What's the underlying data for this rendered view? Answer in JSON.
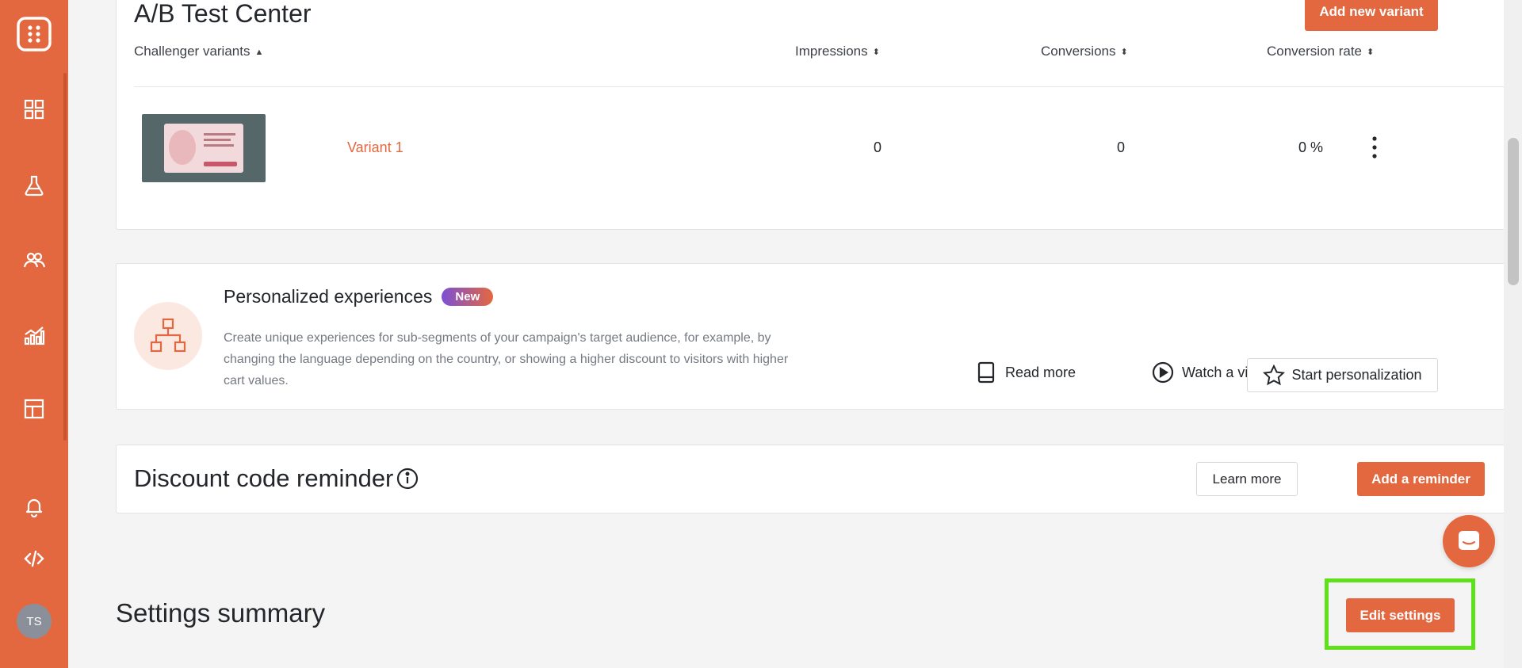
{
  "sidebar": {
    "avatar_initials": "TS",
    "icons": [
      "logo-icon",
      "dashboard-icon",
      "experiment-icon",
      "users-icon",
      "analytics-icon",
      "layout-icon",
      "bell-icon",
      "code-icon"
    ]
  },
  "ab_test": {
    "title": "A/B Test Center",
    "add_variant_label": "Add new variant",
    "columns": {
      "variants": "Challenger variants",
      "impressions": "Impressions",
      "conversions": "Conversions",
      "rate": "Conversion rate"
    },
    "rows": [
      {
        "name": "Variant 1",
        "impressions": "0",
        "conversions": "0",
        "rate": "0 %"
      }
    ]
  },
  "personalized": {
    "title": "Personalized experiences",
    "badge": "New",
    "description": "Create unique experiences for sub-segments of your campaign's target audience, for example, by changing the language depending on the country, or showing a higher discount to visitors with higher cart values.",
    "read_more": "Read more",
    "watch_video": "Watch a video",
    "start": "Start personalization"
  },
  "discount": {
    "title": "Discount code reminder",
    "learn_more": "Learn more",
    "add_reminder": "Add a reminder"
  },
  "settings": {
    "title": "Settings summary",
    "edit_label": "Edit settings"
  },
  "colors": {
    "accent": "#e4683f",
    "highlight": "#5ee01a",
    "badge_start": "#7b4fd6",
    "badge_end": "#e4683f"
  }
}
